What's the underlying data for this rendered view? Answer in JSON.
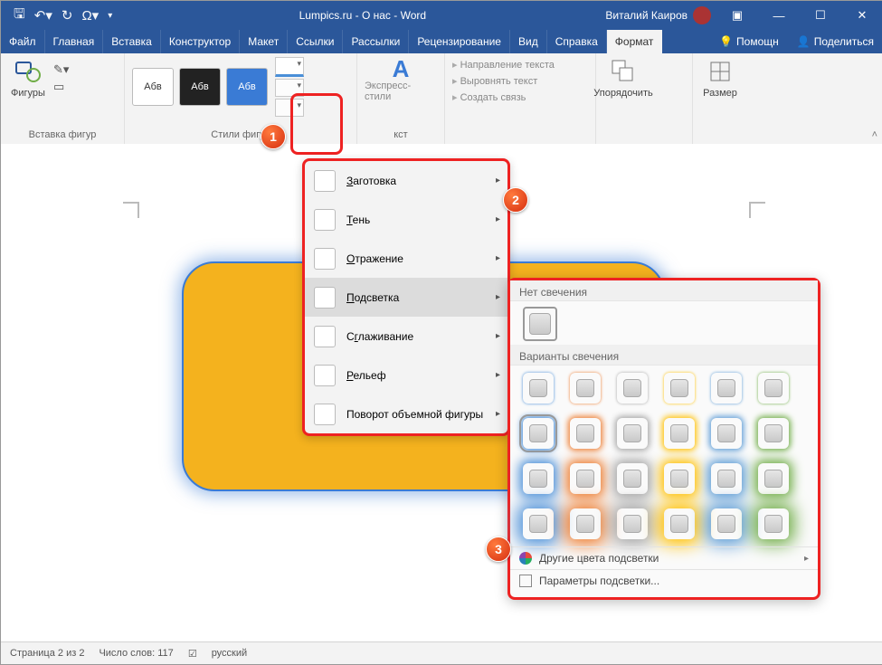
{
  "title": "Lumpics.ru - О нас  -  Word",
  "user": "Виталий Каиров",
  "tabs": [
    "Файл",
    "Главная",
    "Вставка",
    "Конструктор",
    "Макет",
    "Ссылки",
    "Рассылки",
    "Рецензирование",
    "Вид",
    "Справка",
    "Формат"
  ],
  "tabsRight": {
    "help": "Помощн",
    "share": "Поделиться"
  },
  "ribbon": {
    "insertShapes": "Вставка фигур",
    "shapes": "Фигуры",
    "shapeStyles": "Стили фигур",
    "abv": "Абв",
    "express": "Экспресс-стили",
    "wordart": "кст",
    "textdir": "Направление текста",
    "align": "Выровнять текст",
    "link": "Создать связь",
    "arrange": "Упорядочить",
    "size": "Размер"
  },
  "effectsMenu": [
    {
      "label": "Заготовка",
      "u": 0
    },
    {
      "label": "Тень",
      "u": 0
    },
    {
      "label": "Отражение",
      "u": 0
    },
    {
      "label": "Подсветка",
      "u": 0,
      "hover": true
    },
    {
      "label": "Сглаживание",
      "u": 1
    },
    {
      "label": "Рельеф",
      "u": 0
    },
    {
      "label": "Поворот объемной фигуры",
      "u": -1
    }
  ],
  "glow": {
    "none": "Нет свечения",
    "variants": "Варианты свечения",
    "colors": [
      "#4a8fd8",
      "#ed7d31",
      "#a5a5a5",
      "#ffc000",
      "#5b9bd5",
      "#70ad47"
    ],
    "moreColors": "Другие цвета подсветки",
    "options": "Параметры подсветки..."
  },
  "status": {
    "page": "Страница 2 из 2",
    "words": "Число слов: 117",
    "lang": "русский"
  }
}
